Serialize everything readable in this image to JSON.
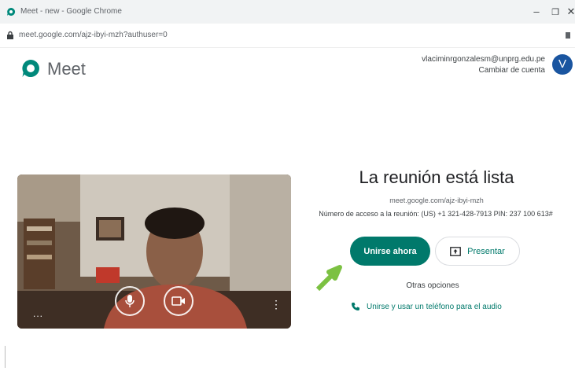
{
  "browser": {
    "tab_title": "Meet - new - Google Chrome",
    "url": "meet.google.com/ajz-ibyi-mzh?authuser=0",
    "minimize": "–",
    "maximize": "❐",
    "close": "✕"
  },
  "header": {
    "brand": "Meet",
    "account_email": "vlaciminrgonzalesm@unprg.edu.pe",
    "switch_account": "Cambiar de cuenta",
    "avatar_letter": "V"
  },
  "preview": {
    "more_left": "...",
    "more_right": "⋮"
  },
  "join_panel": {
    "title": "La reunión está lista",
    "meeting_url": "meet.google.com/ajz-ibyi-mzh",
    "access_info": "Número de acceso a la reunión: (US) +1 321-428-7913  PIN: 237 100 613#",
    "join_label": "Unirse ahora",
    "present_label": "Presentar",
    "other_options": "Otras opciones",
    "phone_audio": "Unirse y usar un teléfono para el audio"
  },
  "colors": {
    "accent": "#00796b",
    "avatar": "#1a55a0",
    "arrow": "#7cc142"
  }
}
